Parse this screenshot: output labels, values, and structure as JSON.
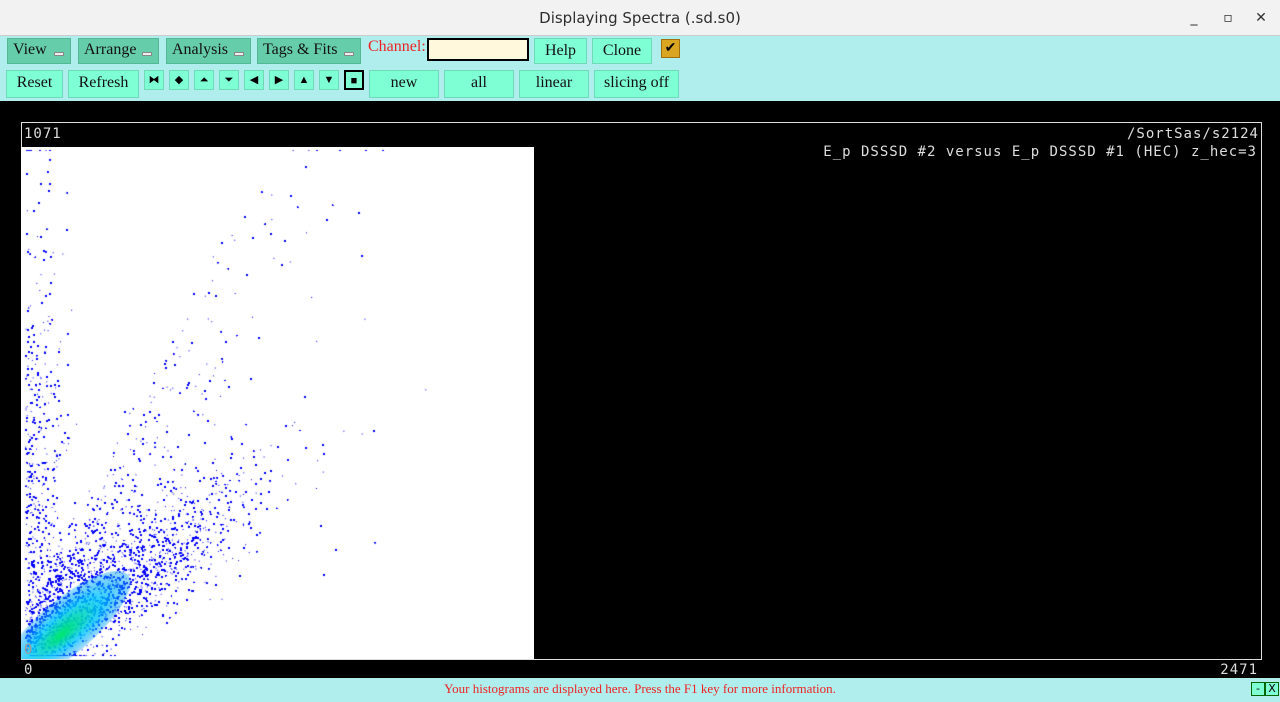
{
  "window": {
    "title": "Displaying Spectra (.sd.s0)",
    "minimize": "_",
    "maximize": "▫",
    "close": "✕"
  },
  "menus": [
    "View",
    "Arrange",
    "Analysis",
    "Tags & Fits"
  ],
  "channel": {
    "label": "Channel:",
    "value": ""
  },
  "buttons": {
    "help": "Help",
    "clone": "Clone",
    "reset": "Reset",
    "refresh": "Refresh",
    "new": "new",
    "all": "all",
    "linear": "linear",
    "slicing": "slicing off"
  },
  "checkbox": {
    "checked": true,
    "glyph": "✔"
  },
  "nav_icons": [
    "⧓",
    "◆",
    "⏶",
    "⏷",
    "◀",
    "▶",
    "▲",
    "▼",
    "■"
  ],
  "plot": {
    "ymax": "1071",
    "path": "/SortSas/s2124",
    "title": "E_p DSSSD #2 versus E_p DSSSD #1 (HEC) z_hec=3",
    "ymin": "0",
    "xmin": "0",
    "xmax": "2471"
  },
  "status": {
    "message": "Your histograms are displayed here. Press the F1 key for more information.",
    "min": "-",
    "close": "X"
  }
}
